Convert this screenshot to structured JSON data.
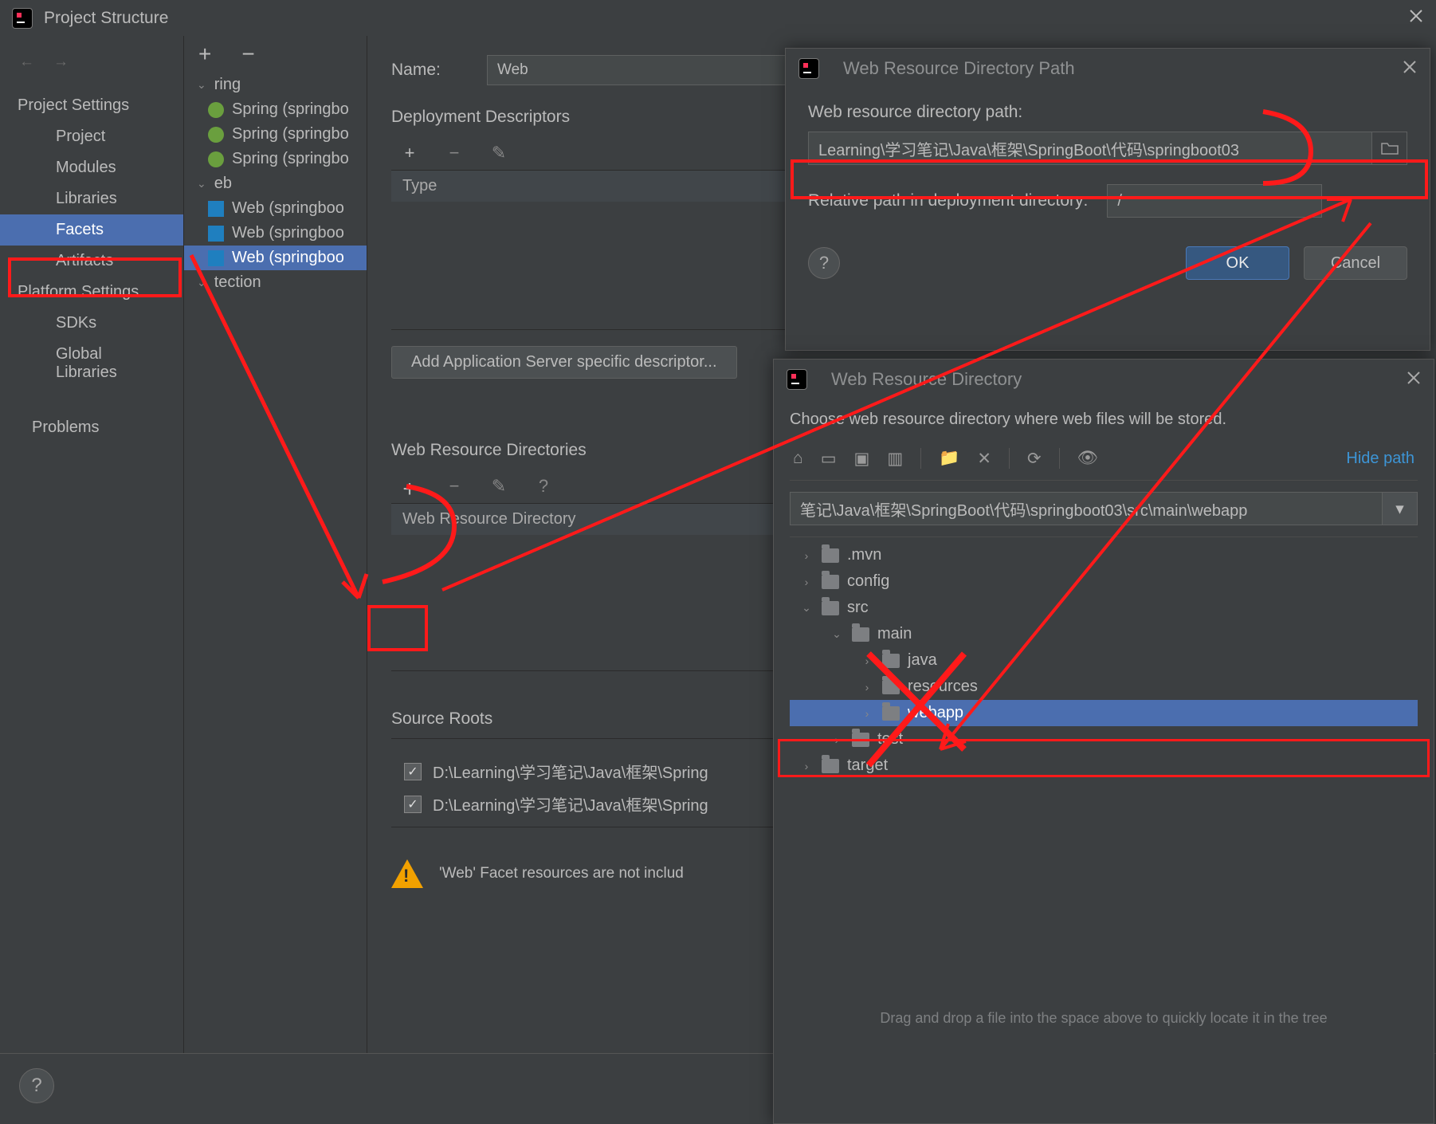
{
  "window": {
    "title": "Project Structure"
  },
  "leftnav": {
    "section1": "Project Settings",
    "items1": [
      "Project",
      "Modules",
      "Libraries",
      "Facets",
      "Artifacts"
    ],
    "section2": "Platform Settings",
    "items2": [
      "SDKs",
      "Global Libraries"
    ],
    "problems": "Problems"
  },
  "facetTree": {
    "spring_group": "ring",
    "springs": [
      "Spring (springbo",
      "Spring (springbo",
      "Spring (springbo"
    ],
    "web_group": "eb",
    "webs": [
      "Web (springboo",
      "Web (springboo",
      "Web (springboo"
    ],
    "detection": "tection"
  },
  "details": {
    "name_label": "Name:",
    "name_value": "Web",
    "deploy_header": "Deployment Descriptors",
    "type_col": "Type",
    "add_server_btn": "Add Application Server specific descriptor...",
    "wrd_header": "Web Resource Directories",
    "wrd_col": "Web Resource Directory",
    "source_roots": "Source Roots",
    "root1": "D:\\Learning\\学习笔记\\Java\\框架\\Spring",
    "root2": "D:\\Learning\\学习笔记\\Java\\框架\\Spring",
    "warn": "'Web' Facet resources are not includ"
  },
  "dlg1": {
    "title": "Web Resource Directory Path",
    "label1": "Web resource directory path:",
    "path": "Learning\\学习笔记\\Java\\框架\\SpringBoot\\代码\\springboot03",
    "label2": "Relative path in deployment directory:",
    "rel": "/",
    "ok": "OK",
    "cancel": "Cancel"
  },
  "dlg2": {
    "title": "Web Resource Directory",
    "instr": "Choose web resource directory where web files will be stored.",
    "hide": "Hide path",
    "combo": "笔记\\Java\\框架\\SpringBoot\\代码\\springboot03\\src\\main\\webapp",
    "tree": [
      {
        "indent": 0,
        "chev": ">",
        "label": ".mvn"
      },
      {
        "indent": 0,
        "chev": ">",
        "label": "config"
      },
      {
        "indent": 0,
        "chev": "v",
        "label": "src"
      },
      {
        "indent": 1,
        "chev": "v",
        "label": "main"
      },
      {
        "indent": 2,
        "chev": ">",
        "label": "java"
      },
      {
        "indent": 2,
        "chev": ">",
        "label": "resources"
      },
      {
        "indent": 2,
        "chev": ">",
        "label": "webapp",
        "selected": true
      },
      {
        "indent": 1,
        "chev": ">",
        "label": "test"
      },
      {
        "indent": 0,
        "chev": ">",
        "label": "target"
      }
    ],
    "hint": "Drag and drop a file into the space above to quickly locate it in the tree"
  }
}
